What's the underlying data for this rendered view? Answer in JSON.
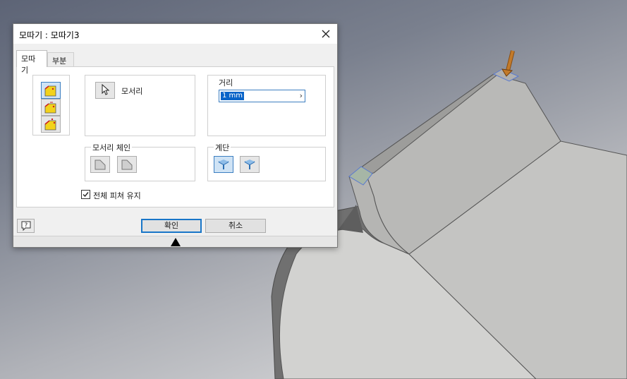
{
  "dialog": {
    "title": "모따기 : 모따기3",
    "tabs": [
      {
        "label": "모따기",
        "active": true
      },
      {
        "label": "부분",
        "active": false
      }
    ],
    "edges_label": "모서리",
    "distance": {
      "label": "거리",
      "value": "1 mm"
    },
    "edge_chain": {
      "label": "모서리 체인"
    },
    "setback": {
      "label": "계단"
    },
    "preserve_features": {
      "label": "전체 피쳐 유지",
      "checked": true
    },
    "buttons": {
      "ok": "확인",
      "cancel": "취소"
    }
  },
  "colors": {
    "accent": "#1976c8",
    "selection": "#0a64c8",
    "model_face": "#c8c8c6",
    "manipulator": "#c27a2a"
  },
  "icons": [
    "close-icon",
    "chamfer-distance-icon",
    "chamfer-distance-angle-icon",
    "chamfer-two-distances-icon",
    "cursor-arrow-icon",
    "chevron-right-icon",
    "chain-edges-icon",
    "individual-edge-icon",
    "setback-on-icon",
    "setback-off-icon",
    "help-icon"
  ]
}
